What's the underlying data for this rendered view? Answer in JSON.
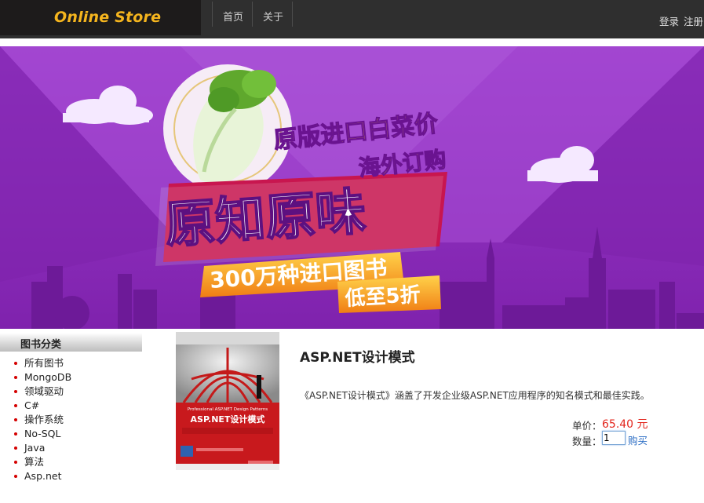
{
  "header": {
    "logo": "Online Store",
    "nav": [
      {
        "label": "首页"
      },
      {
        "label": "关于"
      }
    ],
    "auth": {
      "login": "登录",
      "register": "注册"
    }
  },
  "banner": {
    "line1": "原版进口白菜价",
    "line2": "海外订购",
    "main": "原知原味",
    "line3": "300万种进口图书",
    "line4": "低至5折"
  },
  "sidebar": {
    "title": "图书分类",
    "items": [
      {
        "label": "所有图书"
      },
      {
        "label": "MongoDB"
      },
      {
        "label": "领域驱动"
      },
      {
        "label": "C#"
      },
      {
        "label": "操作系统"
      },
      {
        "label": "No-SQL"
      },
      {
        "label": "Java"
      },
      {
        "label": "算法"
      },
      {
        "label": "Asp.net"
      }
    ]
  },
  "product": {
    "title": "ASP.NET设计模式",
    "description": "《ASP.NET设计模式》涵盖了开发企业级ASP.NET应用程序的知名模式和最佳实践。",
    "price_label": "单价：",
    "price": "65.40 元",
    "qty_label": "数量：",
    "qty": "1",
    "buy": "购买",
    "cover": {
      "series": "Professional ASP.NET Design Patterns",
      "title": "ASP.NET设计模式"
    }
  },
  "colors": {
    "topbar": "#2f2f2f",
    "logo_bg": "#1d1b1b",
    "logo_text": "#f5b51e",
    "banner_purple": "#8f2fbf",
    "price_red": "#e2231a",
    "link_blue": "#2a6cc4"
  }
}
